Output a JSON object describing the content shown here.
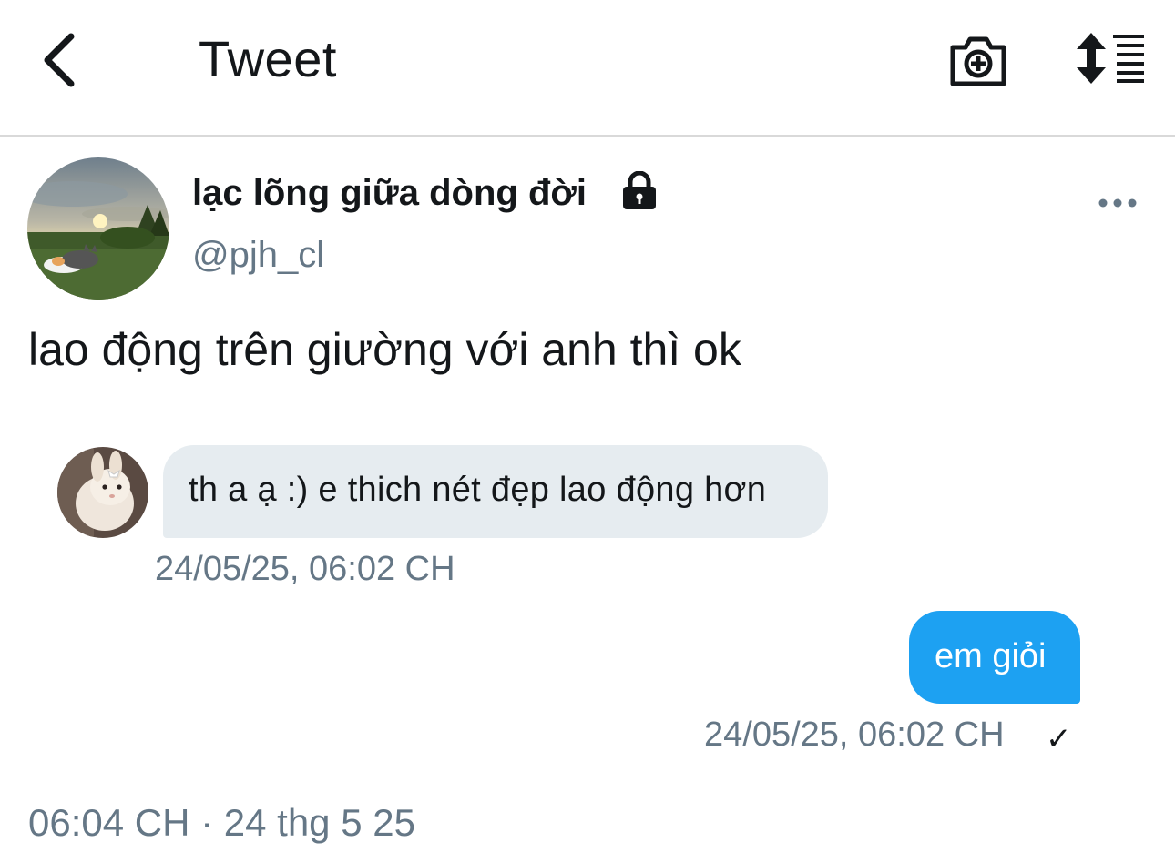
{
  "header": {
    "title": "Tweet",
    "back_icon": "chevron-left-icon",
    "camera_icon": "camera-plus-icon",
    "sort_icon": "sort-list-icon"
  },
  "author": {
    "display_name": "lạc lõng giữa dòng đời",
    "handle": "@pjh_cl",
    "protected_icon": "lock-icon",
    "more_icon": "more-horizontal-icon"
  },
  "tweet": {
    "text": "lao động trên giường với anh thì ok",
    "meta": "06:04 CH · 24 thg 5 25"
  },
  "conversation": {
    "incoming": {
      "text": "th a ạ :) e thich nét đẹp lao động hơn",
      "timestamp": "24/05/25, 06:02 CH"
    },
    "outgoing": {
      "text": "em giỏi",
      "timestamp": "24/05/25, 06:02 CH",
      "status_icon": "checkmark-icon",
      "status_glyph": "✓"
    }
  },
  "colors": {
    "primary_text": "#14171a",
    "secondary_text": "#657786",
    "incoming_bubble": "#e6ecf0",
    "outgoing_bubble": "#1da1f2"
  }
}
